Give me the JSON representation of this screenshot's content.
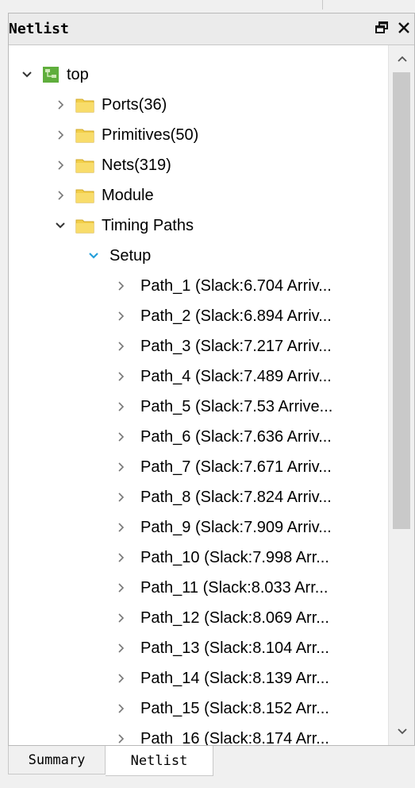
{
  "panel": {
    "title": "Netlist",
    "float_icon": "float-window-icon",
    "close_icon": "close-icon"
  },
  "tree": {
    "root": {
      "label": "top",
      "expanded": true,
      "icon": "module-icon"
    },
    "folders": [
      {
        "label": "Ports(36)",
        "expanded": false
      },
      {
        "label": "Primitives(50)",
        "expanded": false
      },
      {
        "label": "Nets(319)",
        "expanded": false
      },
      {
        "label": "Module",
        "expanded": false
      },
      {
        "label": "Timing Paths",
        "expanded": true
      }
    ],
    "setup": {
      "label": "Setup",
      "expanded": true
    },
    "paths": [
      "Path_1 (Slack:6.704 Arriv...",
      "Path_2 (Slack:6.894 Arriv...",
      "Path_3 (Slack:7.217 Arriv...",
      "Path_4 (Slack:7.489 Arriv...",
      "Path_5 (Slack:7.53 Arrive...",
      "Path_6 (Slack:7.636 Arriv...",
      "Path_7 (Slack:7.671 Arriv...",
      "Path_8 (Slack:7.824 Arriv...",
      "Path_9 (Slack:7.909 Arriv...",
      "Path_10 (Slack:7.998 Arr...",
      "Path_11 (Slack:8.033 Arr...",
      "Path_12 (Slack:8.069 Arr...",
      "Path_13 (Slack:8.104 Arr...",
      "Path_14 (Slack:8.139 Arr...",
      "Path_15 (Slack:8.152 Arr...",
      "Path_16 (Slack:8.174 Arr..."
    ]
  },
  "tabs": {
    "summary": "Summary",
    "netlist": "Netlist"
  },
  "colors": {
    "folder": "#f2cf4a",
    "setup_chevron": "#26a0da",
    "module_icon": "#5fae3c"
  }
}
